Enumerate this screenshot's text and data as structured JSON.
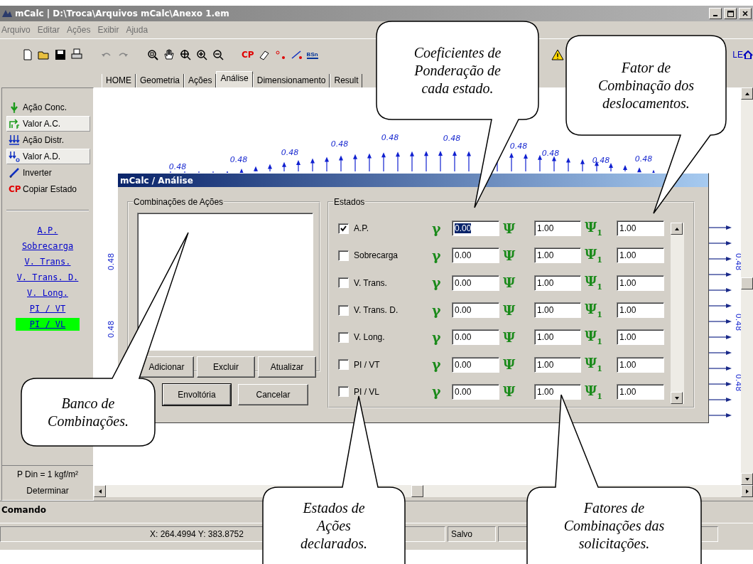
{
  "window": {
    "title": "mCalc | D:\\Troca\\Arquivos mCalc\\Anexo 1.em"
  },
  "menu": [
    "Arquivo",
    "Editar",
    "Ações",
    "Exibir",
    "Ajuda"
  ],
  "toolbar": {
    "cp_label": "CP",
    "bsn_label": "BSn",
    "le_label": "LE"
  },
  "tabs": [
    {
      "label": "HOME",
      "selected": false
    },
    {
      "label": "Geometria",
      "selected": false
    },
    {
      "label": "Ações",
      "selected": false
    },
    {
      "label": "Análise",
      "selected": true
    },
    {
      "label": "Dimensionamento",
      "selected": false
    },
    {
      "label": "Result",
      "selected": false
    }
  ],
  "tools": [
    {
      "label": "Ação Conc.",
      "pressed": false
    },
    {
      "label": "Valor A.C.",
      "pressed": true
    },
    {
      "label": "Ação Distr.",
      "pressed": false
    },
    {
      "label": "Valor A.D.",
      "pressed": true
    },
    {
      "label": "Inverter",
      "pressed": false
    },
    {
      "label": "Copiar Estado",
      "pressed": false,
      "icon_text": "CP"
    }
  ],
  "states": [
    {
      "label": "A.P.",
      "selected": false
    },
    {
      "label": "Sobrecarga",
      "selected": false
    },
    {
      "label": "V. Trans.",
      "selected": false
    },
    {
      "label": "V. Trans. D.",
      "selected": false
    },
    {
      "label": "V. Long.",
      "selected": false
    },
    {
      "label": "PI / VT",
      "selected": false
    },
    {
      "label": "PI / VL",
      "selected": true
    }
  ],
  "pressure": "P Din = 1 kgf/m²",
  "determine_button": "Determinar",
  "canvas": {
    "top_labels": [
      "0.48",
      "0.48",
      "0.48",
      "0.48",
      "0.48",
      "0.48",
      "0.48",
      "0.48",
      "0.48",
      "0.48"
    ],
    "left_labels": [
      "0.48",
      "0.48"
    ],
    "right_labels": [
      "0.48",
      "0.48",
      "0.48"
    ]
  },
  "dialog": {
    "title": "mCalc / Análise",
    "combinations_title": "Combinações de Ações",
    "list_buttons": [
      "Adicionar",
      "Excluir",
      "Atualizar"
    ],
    "bottom_buttons": [
      "Envoltória",
      "Cancelar"
    ],
    "states_title": "Estados",
    "rows": [
      {
        "label": "A.P.",
        "checked": true,
        "gamma_symbol": "γ",
        "gamma": "0.00",
        "gamma_selected": true,
        "psi_symbol": "Ψ",
        "psi": "1.00",
        "psi1_symbol": "Ψ$_{1}$",
        "psi1": "1.00"
      },
      {
        "label": "Sobrecarga",
        "checked": false,
        "gamma_symbol": "γ",
        "gamma": "0.00",
        "gamma_selected": false,
        "psi_symbol": "Ψ",
        "psi": "1.00",
        "psi1_symbol": "Ψ$_{1}$",
        "psi1": "1.00"
      },
      {
        "label": "V. Trans.",
        "checked": false,
        "gamma_symbol": "γ",
        "gamma": "0.00",
        "gamma_selected": false,
        "psi_symbol": "Ψ",
        "psi": "1.00",
        "psi1_symbol": "Ψ$_{1}$",
        "psi1": "1.00"
      },
      {
        "label": "V. Trans. D.",
        "checked": false,
        "gamma_symbol": "γ",
        "gamma": "0.00",
        "gamma_selected": false,
        "psi_symbol": "Ψ",
        "psi": "1.00",
        "psi1_symbol": "Ψ$_{1}$",
        "psi1": "1.00"
      },
      {
        "label": "V. Long.",
        "checked": false,
        "gamma_symbol": "γ",
        "gamma": "0.00",
        "gamma_selected": false,
        "psi_symbol": "Ψ",
        "psi": "1.00",
        "psi1_symbol": "Ψ$_{1}$",
        "psi1": "1.00"
      },
      {
        "label": "PI / VT",
        "checked": false,
        "gamma_symbol": "γ",
        "gamma": "0.00",
        "gamma_selected": false,
        "psi_symbol": "Ψ",
        "psi": "1.00",
        "psi1_symbol": "Ψ$_{1}$",
        "psi1": "1.00"
      },
      {
        "label": "PI / VL",
        "checked": false,
        "gamma_symbol": "γ",
        "gamma": "0.00",
        "gamma_selected": false,
        "psi_symbol": "Ψ",
        "psi": "1.00",
        "psi1_symbol": "Ψ$_{1}$",
        "psi1": "1.00"
      }
    ]
  },
  "command": {
    "label": "Comando"
  },
  "status_bar": {
    "coords": "X: 264.4994  Y: 383.8752",
    "state": "Salvo"
  },
  "callouts": [
    {
      "lines": [
        "Coeficientes de",
        "Ponderação de",
        "cada estado."
      ]
    },
    {
      "lines": [
        "Fator de",
        "Combinação dos",
        "deslocamentos."
      ]
    },
    {
      "lines": [
        "Banco de",
        "Combinações."
      ]
    },
    {
      "lines": [
        "Estados de",
        "Ações",
        "declarados."
      ]
    },
    {
      "lines": [
        "Fatores de",
        "Combinações das",
        "solicitações."
      ]
    }
  ]
}
